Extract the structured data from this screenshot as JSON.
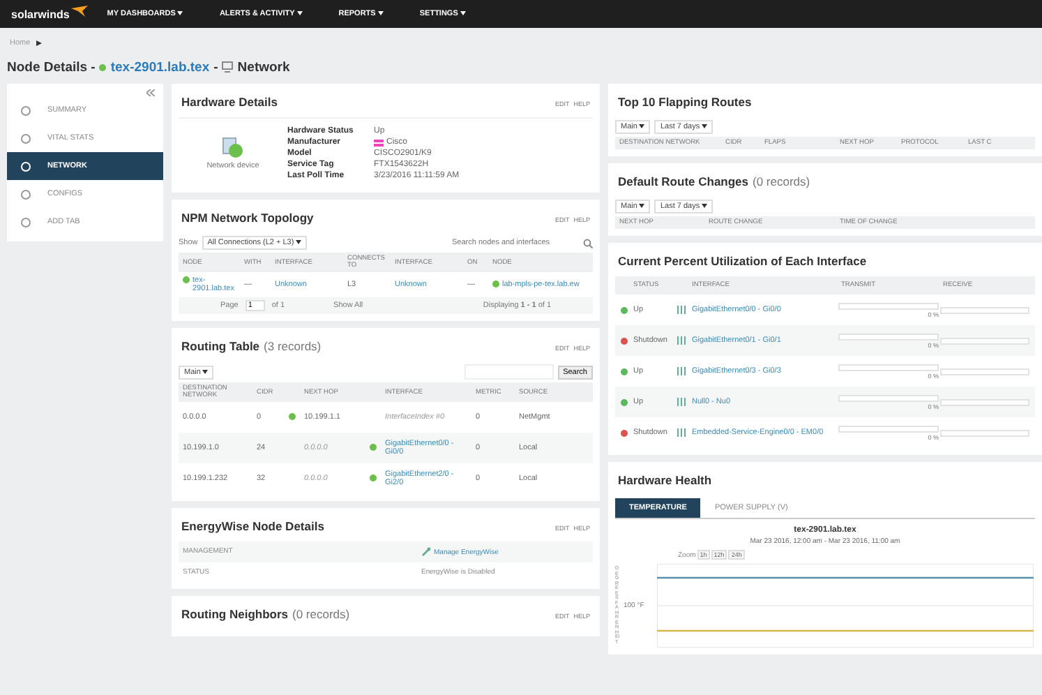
{
  "header": {
    "logo": "solarwinds",
    "menu": [
      {
        "label": "MY DASHBOARDS"
      },
      {
        "label": "ALERTS & ACTIVITY"
      },
      {
        "label": "REPORTS"
      },
      {
        "label": "SETTINGS"
      }
    ]
  },
  "breadcrumb": {
    "label": "Home"
  },
  "page_title": {
    "prefix": "Node Details -",
    "node": "tex-2901.lab.tex",
    "separator": "-",
    "view": "Network"
  },
  "sidebar": {
    "items": [
      {
        "label": "SUMMARY",
        "selected": false
      },
      {
        "label": "VITAL STATS",
        "selected": false
      },
      {
        "label": "NETWORK",
        "selected": true
      },
      {
        "label": "CONFIGS",
        "selected": false
      },
      {
        "label": "ADD TAB",
        "selected": false
      }
    ]
  },
  "hardware_details": {
    "title": "Hardware Details",
    "actions": [
      "EDIT",
      "HELP"
    ],
    "device_label": "Network device",
    "rows": [
      {
        "label": "Hardware Status",
        "value": "Up",
        "kind": "text"
      },
      {
        "label": "Manufacturer",
        "value": "Cisco",
        "kind": "vendor"
      },
      {
        "label": "Model",
        "value": "CISCO2901/K9",
        "kind": "text"
      },
      {
        "label": "Service Tag",
        "value": "FTX1543622H",
        "kind": "text"
      },
      {
        "label": "Last Poll Time",
        "value": "3/23/2016 11:11:59 AM",
        "kind": "text"
      }
    ]
  },
  "topology": {
    "title": "NPM Network Topology",
    "actions": [
      "EDIT",
      "HELP"
    ],
    "show_label": "Show",
    "filter": "All Connections (L2 + L3)",
    "search_placeholder": "Search nodes and interfaces",
    "columns": [
      "NODE",
      "WITH",
      "INTERFACE",
      "CONNECTS TO",
      "INTERFACE",
      "ON",
      "NODE"
    ],
    "rows": [
      {
        "node": "tex-2901.lab.tex",
        "with": "—",
        "interface": "Unknown",
        "connects_to": "L3",
        "interface_2": "Unknown",
        "on": "—",
        "node_2": "lab-mpls-pe-tex.lab.ew"
      }
    ],
    "pager": {
      "page_label": "Page",
      "page": "1",
      "of": "of 1",
      "show_all": "Show All",
      "displaying": "Displaying **1 - 1** of 1"
    }
  },
  "routing_table": {
    "title": "Routing Table",
    "count": "(3 records)",
    "actions": [
      "EDIT",
      "HELP"
    ],
    "filter": "Main",
    "search_button": "Search",
    "columns": [
      "DESTINATION NETWORK",
      "CIDR",
      "NEXT HOP",
      "INTERFACE",
      "METRIC",
      "SOURCE"
    ],
    "rows": [
      {
        "destination": "0.0.0.0",
        "cidr": "0",
        "next_hop_up": true,
        "next_hop": "10.199.1.1",
        "interface_up": false,
        "interface": "InterfaceIndex #0",
        "metric": "0",
        "source": "NetMgmt"
      },
      {
        "destination": "10.199.1.0",
        "cidr": "24",
        "next_hop_up": false,
        "next_hop": "0.0.0.0",
        "interface_up": true,
        "interface": "GigabitEthernet0/0 - Gi0/0",
        "metric": "0",
        "source": "Local"
      },
      {
        "destination": "10.199.1.232",
        "cidr": "32",
        "next_hop_up": false,
        "next_hop": "0.0.0.0",
        "interface_up": true,
        "interface": "GigabitEthernet2/0 - Gi2/0",
        "metric": "0",
        "source": "Local"
      }
    ]
  },
  "energywise": {
    "title": "EnergyWise Node Details",
    "actions": [
      "EDIT",
      "HELP"
    ],
    "rows": [
      {
        "label": "MANAGEMENT",
        "value": "Manage EnergyWise",
        "kind": "link"
      },
      {
        "label": "STATUS",
        "value": "EnergyWise is Disabled",
        "kind": "text"
      }
    ]
  },
  "routing_neighbors": {
    "title": "Routing Neighbors",
    "count": "(0 records)",
    "actions": [
      "EDIT",
      "HELP"
    ]
  },
  "flapping_routes": {
    "title": "Top 10 Flapping Routes",
    "filters": [
      "Main",
      "Last 7 days"
    ],
    "columns": [
      "DESTINATION NETWORK",
      "CIDR",
      "FLAPS",
      "NEXT HOP",
      "PROTOCOL",
      "LAST C"
    ]
  },
  "default_route_changes": {
    "title": "Default Route Changes",
    "count": "(0 records)",
    "filters": [
      "Main",
      "Last 7 days"
    ],
    "columns": [
      "NEXT HOP",
      "ROUTE CHANGE",
      "TIME OF CHANGE"
    ]
  },
  "utilization": {
    "title": "Current Percent Utilization of Each Interface",
    "columns": [
      "STATUS",
      "INTERFACE",
      "TRANSMIT",
      "RECEIVE"
    ],
    "rows": [
      {
        "status": "Up",
        "color": "#5cb85c",
        "interface": "GigabitEthernet0/0 - Gi0/0",
        "transmit": {
          "level": 0,
          "reading": "0 %"
        },
        "receive": {
          "level": 0
        }
      },
      {
        "status": "Shutdown",
        "color": "#d9534f",
        "interface": "GigabitEthernet0/1 - Gi0/1",
        "transmit": {
          "level": 0,
          "reading": "0 %"
        },
        "receive": {
          "level": 0
        }
      },
      {
        "status": "Up",
        "color": "#5cb85c",
        "interface": "GigabitEthernet0/3 - Gi0/3",
        "transmit": {
          "level": 0,
          "reading": "0 %"
        },
        "receive": {
          "level": 0
        }
      },
      {
        "status": "Up",
        "color": "#5cb85c",
        "interface": "Null0 - Nu0",
        "transmit": {
          "level": 0,
          "reading": "0 %"
        },
        "receive": {
          "level": 0
        }
      },
      {
        "status": "Shutdown",
        "color": "#d9534f",
        "interface": "Embedded-Service-Engine0/0 - EM0/0",
        "transmit": {
          "level": 0,
          "reading": "0 %"
        },
        "receive": {
          "level": 0
        }
      }
    ]
  },
  "hardware_health": {
    "title": "Hardware Health",
    "tabs": [
      {
        "label": "TEMPERATURE",
        "selected": true
      },
      {
        "label": "POWER SUPPLY (V)",
        "selected": false
      }
    ],
    "chart": {
      "title": "tex-2901.lab.tex",
      "subtitle": "Mar 23 2016, 12:00 am - Mar 23 2016, 11:00 am",
      "zoom_label": "Zoom",
      "zoom_options": [
        "1h",
        "12h",
        "24h"
      ],
      "ylabel": "DEGREES FAHRENHEIT",
      "tick": "100 °F"
    }
  }
}
